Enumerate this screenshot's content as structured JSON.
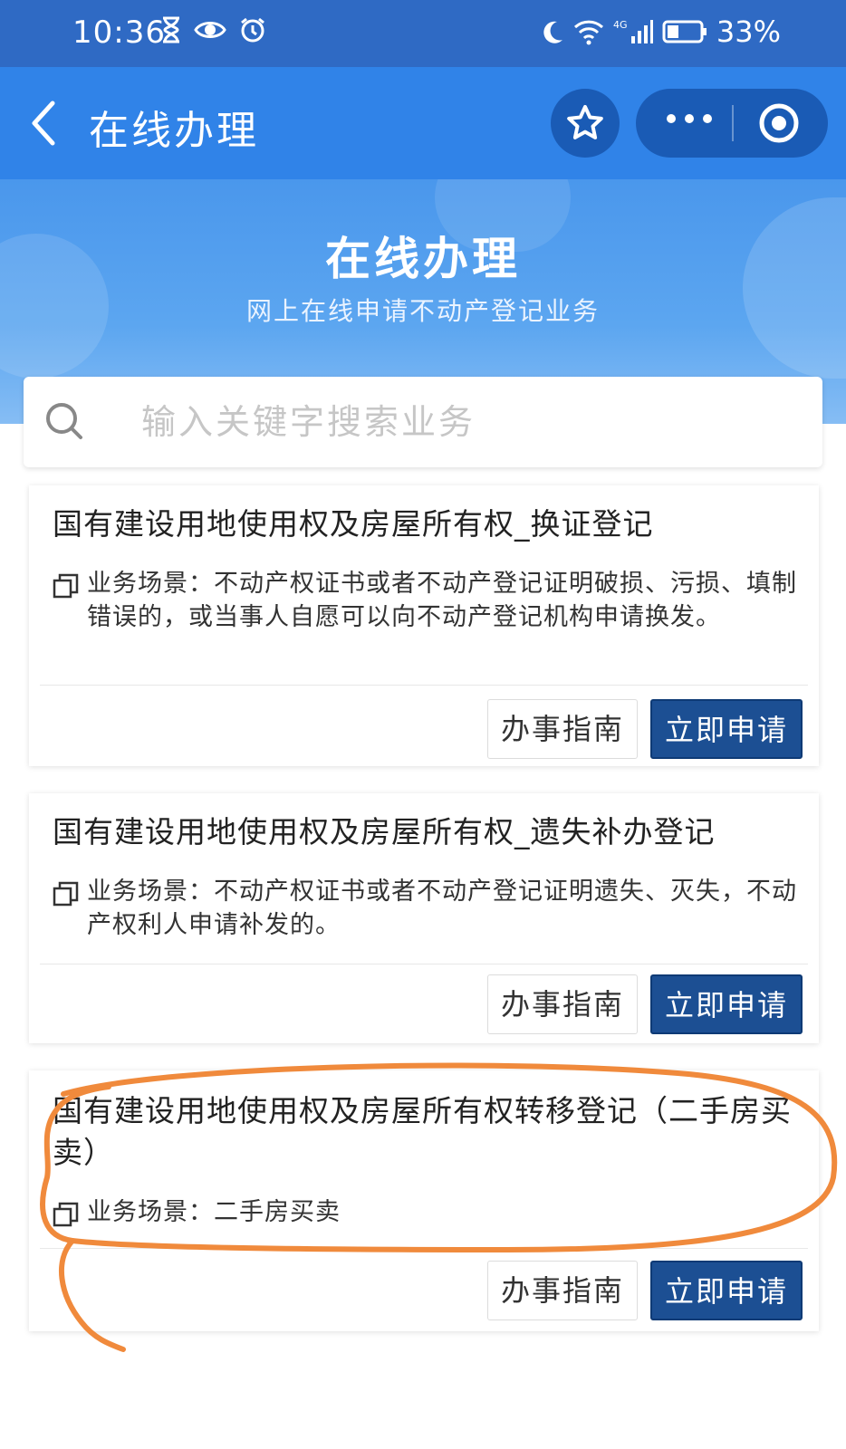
{
  "status_bar": {
    "time": "10:36",
    "network": "4G",
    "battery": "33%"
  },
  "nav": {
    "title": "在线办理",
    "icons": [
      "back-arrow-icon",
      "star-icon",
      "more-dots-icon",
      "record-icon"
    ]
  },
  "hero": {
    "title": "在线办理",
    "subtitle": "网上在线申请不动产登记业务"
  },
  "search": {
    "placeholder": "输入关键字搜索业务",
    "value": ""
  },
  "cards": [
    {
      "title": "国有建设用地使用权及房屋所有权_换证登记",
      "scene": "业务场景：不动产权证书或者不动产登记证明破损、污损、填制错误的，或当事人自愿可以向不动产登记机构申请换发。",
      "guide_label": "办事指南",
      "apply_label": "立即申请"
    },
    {
      "title": "国有建设用地使用权及房屋所有权_遗失补办登记",
      "scene": "业务场景：不动产权证书或者不动产登记证明遗失、灭失，不动产权利人申请补发的。",
      "guide_label": "办事指南",
      "apply_label": "立即申请"
    },
    {
      "title": "国有建设用地使用权及房屋所有权转移登记（二手房买卖）",
      "scene": "业务场景：二手房买卖",
      "guide_label": "办事指南",
      "apply_label": "立即申请"
    }
  ],
  "colors": {
    "status_bar": "#2f6ac4",
    "nav_bar": "#3083e8",
    "apply_button": "#1c4f93",
    "annotation_stroke": "#f08a3c"
  }
}
